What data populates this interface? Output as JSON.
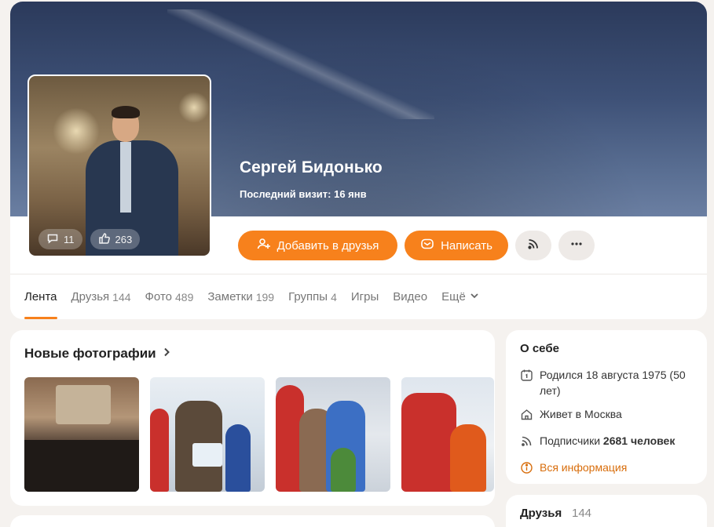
{
  "profile": {
    "name": "Сергей Бидонько",
    "last_visit": "Последний визит: 16 янв",
    "avatar_stats": {
      "comments": "11",
      "likes": "263"
    }
  },
  "actions": {
    "add_friend": "Добавить в друзья",
    "write": "Написать"
  },
  "tabs": [
    {
      "label": "Лента",
      "count": ""
    },
    {
      "label": "Друзья",
      "count": "144"
    },
    {
      "label": "Фото",
      "count": "489"
    },
    {
      "label": "Заметки",
      "count": "199"
    },
    {
      "label": "Группы",
      "count": "4"
    },
    {
      "label": "Игры",
      "count": ""
    },
    {
      "label": "Видео",
      "count": ""
    },
    {
      "label": "Ещё",
      "count": ""
    }
  ],
  "photos": {
    "title": "Новые фотографии"
  },
  "about": {
    "title": "О себе",
    "born": "Родился 18 августа 1975 (50 лет)",
    "lives_prefix": "Живет в ",
    "lives_city": "Москва",
    "subscribers_prefix": "Подписчики ",
    "subscribers_count": "2681 человек",
    "all_info": "Вся информация"
  },
  "friends": {
    "title": "Друзья",
    "count": "144"
  },
  "colors": {
    "accent": "#f7811c",
    "link": "#d86d0b"
  }
}
